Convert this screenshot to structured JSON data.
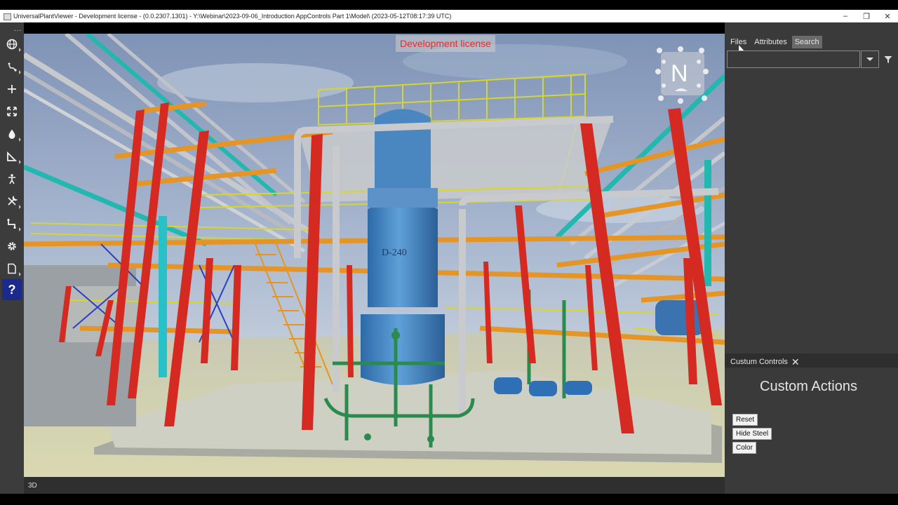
{
  "window": {
    "title": "UniversalPlantViewer - Development license - (0.0.2307.1301) - Y:\\Webinar\\2023-09-06_Introduction AppControls Part 1\\Model\\ (2023-05-12T08:17:39 UTC)",
    "minimize": "–",
    "restore": "❐",
    "close": "✕"
  },
  "toolbar": {
    "more_label": "...",
    "tools": [
      {
        "name": "globe-icon"
      },
      {
        "name": "walk-path-icon"
      },
      {
        "name": "crosshair-icon"
      },
      {
        "name": "expand-icon"
      },
      {
        "name": "drop-icon"
      },
      {
        "name": "measure-icon"
      },
      {
        "name": "person-icon"
      },
      {
        "name": "tools-icon"
      },
      {
        "name": "route-icon"
      },
      {
        "name": "gear-icon"
      },
      {
        "name": "document-icon"
      },
      {
        "name": "help-icon",
        "label": "?"
      }
    ]
  },
  "viewport": {
    "dev_license_label": "Development license",
    "navcube_label": "N",
    "vessel_tag": "D-240",
    "mode_label": "3D"
  },
  "panel": {
    "tabs": [
      {
        "label": "Files",
        "active": false
      },
      {
        "label": "Attributes",
        "active": false
      },
      {
        "label": "Search",
        "active": true
      }
    ],
    "search_value": ""
  },
  "custom_controls": {
    "header": "Custum Controls",
    "close_label": "✕",
    "title": "Custom Actions",
    "buttons": [
      "Reset",
      "Hide Steel",
      "Color"
    ]
  },
  "colors": {
    "steel_red": "#d42a22",
    "steel_yellow": "#d8d62a",
    "steel_orange": "#e49526",
    "vessel_blue": "#3f82c4",
    "pipe_cyan": "#22b8b0",
    "pipe_green": "#2b8a4e",
    "active_tool": "#1c2a8c"
  }
}
